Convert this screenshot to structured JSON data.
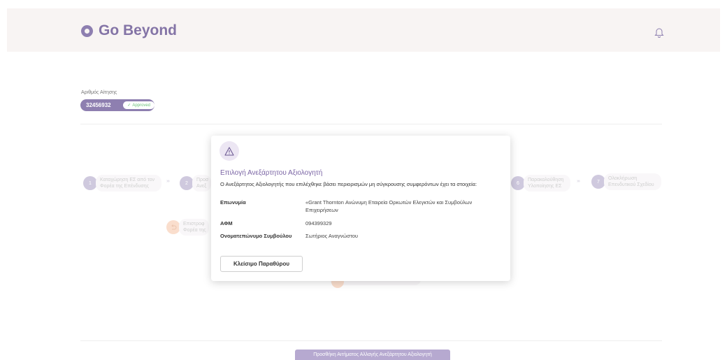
{
  "header": {
    "brand": "Go Beyond"
  },
  "application": {
    "label": "Αριθμός Αίτησης",
    "number": "32456932",
    "status": "Approved"
  },
  "steps": [
    {
      "number": "1",
      "label_line1": "Καταχώρηση ΕΣ από τον",
      "label_line2": "Φορέα της Επένδυσης"
    },
    {
      "number": "2",
      "label_line1": "Προσ",
      "label_line2": "Ανεξ"
    },
    {
      "number": "6",
      "label_line1": "Παρακολούθηση",
      "label_line2": "Υλοποίησης ΕΣ"
    },
    {
      "number": "7",
      "label_line1": "Ολοκλήρωση",
      "label_line2": "Επενδυτικού Σχεδίου"
    }
  ],
  "return_step": {
    "label_line1": "Επιστροφ",
    "label_line2": "Φορέα της"
  },
  "modal": {
    "title": "Επιλογή Ανεξάρτητου Αξιολογητή",
    "description": "Ο Ανεξάρτητος Αξιολογητής που επιλέχθηκε βάσει περιορισμών μη σύγκρουσης συμφερόντων έχει τα στοιχεία:",
    "rows": [
      {
        "label": "Επωνυμία",
        "value": "«Grant Thornton Ανώνυμη Εταιρεία Ορκωτών Ελεγκτών και Συμβούλων Επιχειρήσεων"
      },
      {
        "label": "ΑΦΜ",
        "value": "094399329"
      },
      {
        "label": "Ονοματεπώνυμο Συμβούλου",
        "value": "Σωτήριος Αναγνώστου"
      }
    ],
    "close_label": "Κλείσιμο Παραθύρου"
  },
  "footer": {
    "add_request_label": "Προσθήκη Αιτήματος Αλλαγής Ανεξάρτητου Αξιολογητή"
  },
  "colors": {
    "accent": "#8e7fb0",
    "approved": "#6bbf7a",
    "warning_bg": "#ece6f3"
  },
  "icons": {
    "logo": "logo-circle-icon",
    "bell": "bell-icon",
    "warning": "warning-triangle-icon",
    "undo": "undo-arrow-icon",
    "check": "check-icon"
  }
}
